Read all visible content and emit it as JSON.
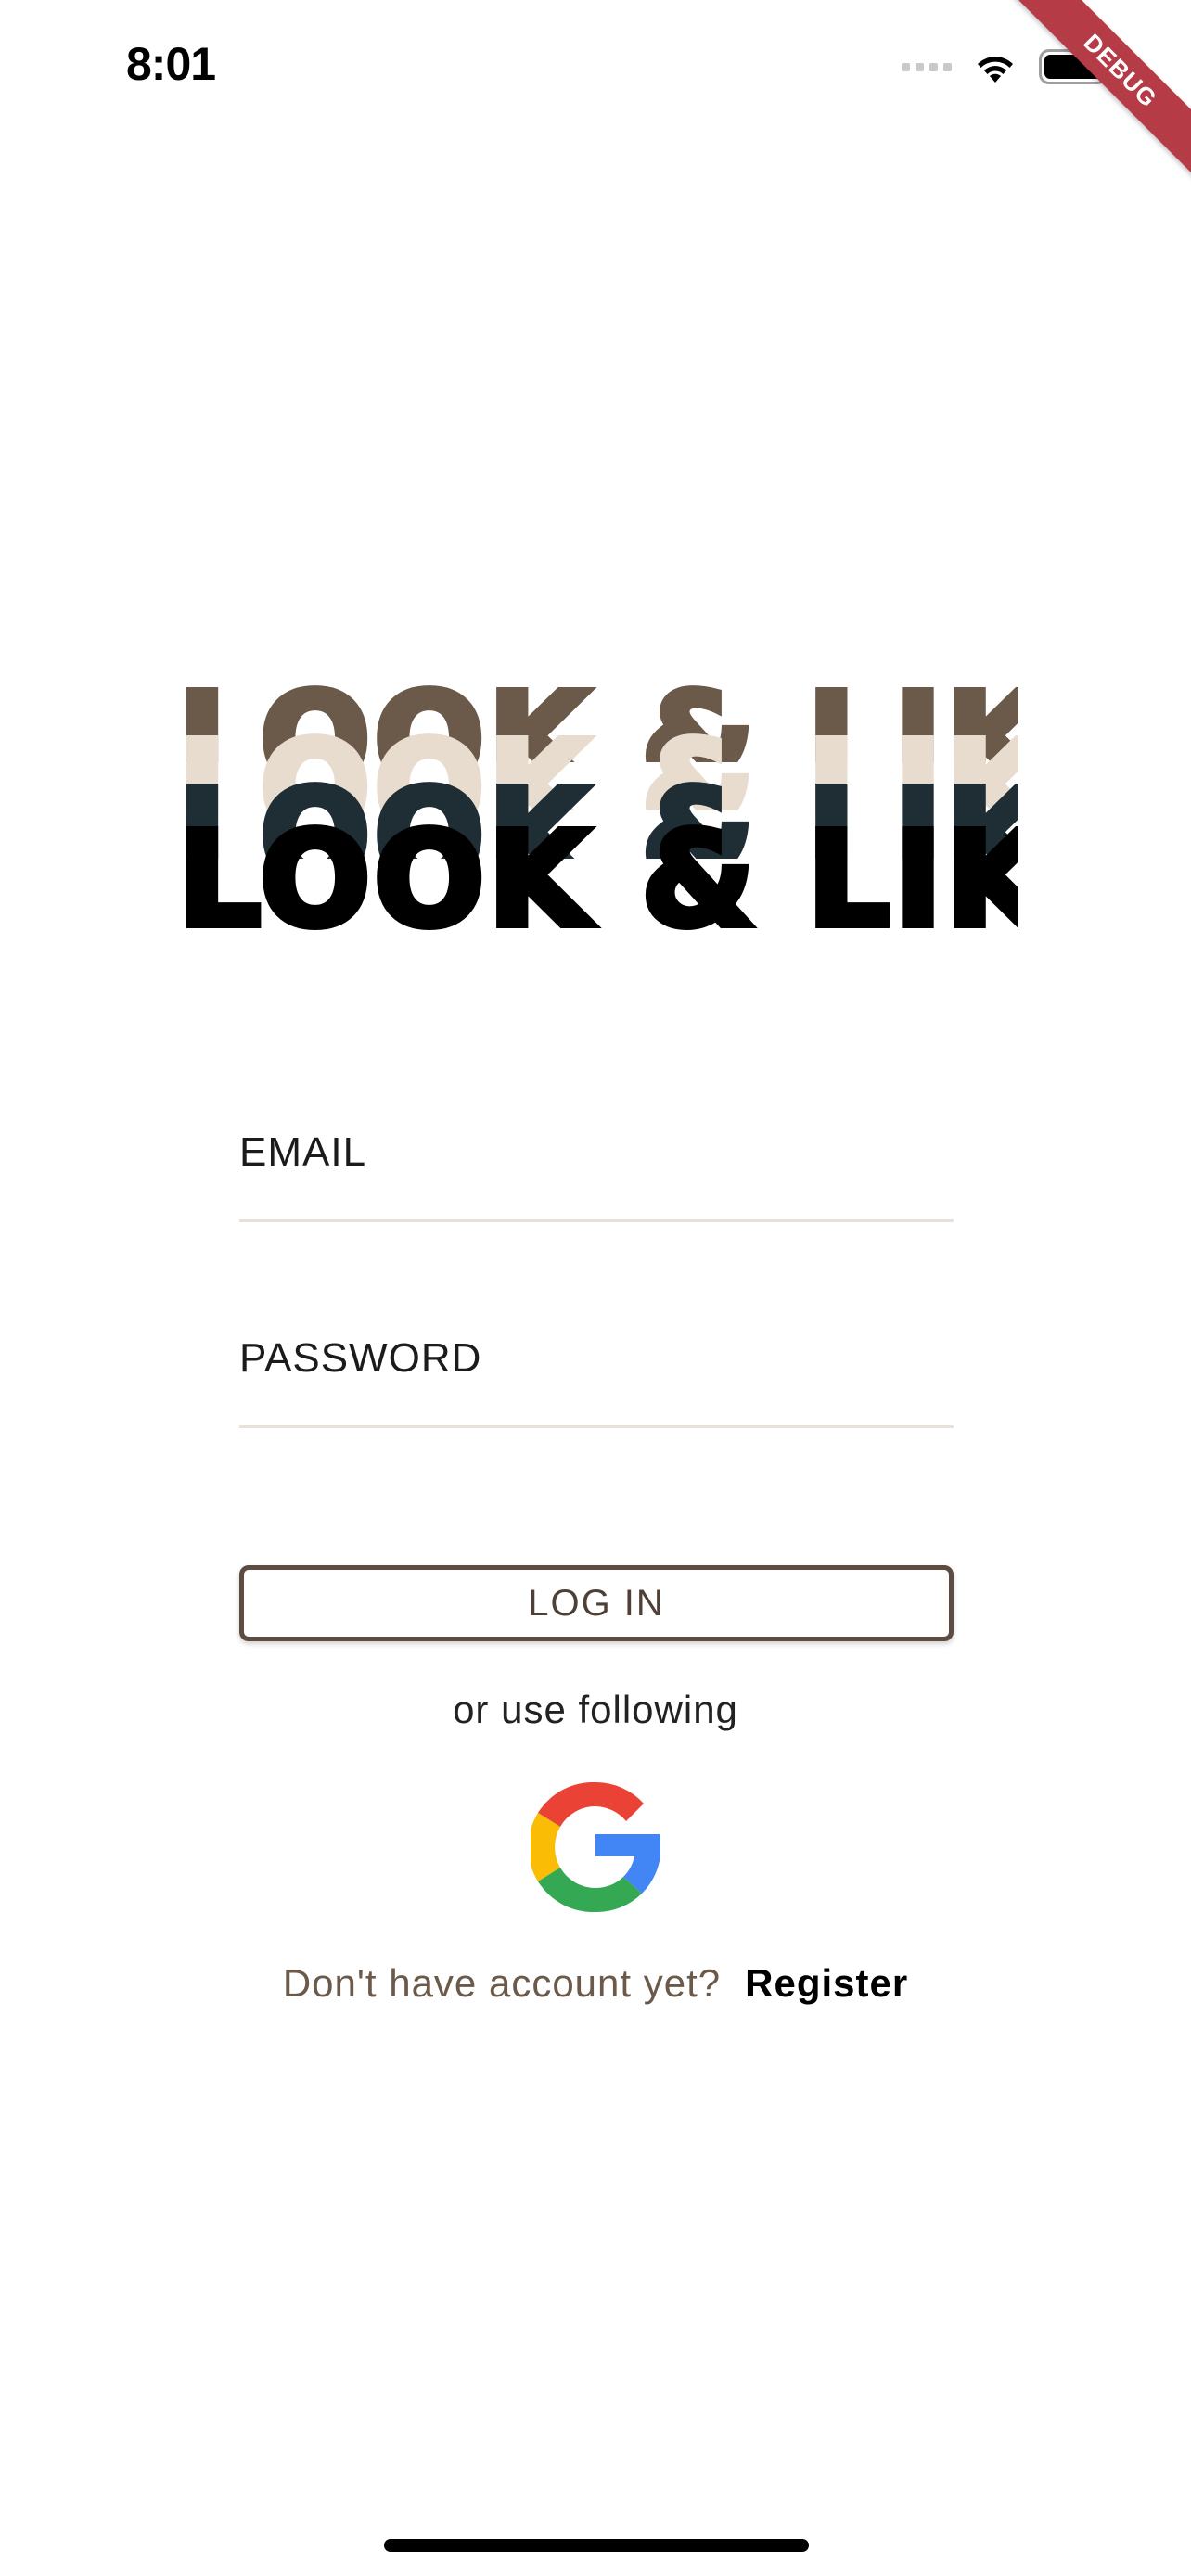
{
  "status_bar": {
    "time": "8:01",
    "icons": [
      "cellular-signal-icon",
      "wifi-icon",
      "battery-icon"
    ]
  },
  "debug_banner": {
    "label": "DEBUG",
    "color": "#b53b46"
  },
  "logo": {
    "text": "LOOK & LIKE",
    "layer_colors": [
      "#6b5a4a",
      "#e8dccf",
      "#1f2e35",
      "#000000"
    ]
  },
  "form": {
    "email_placeholder": "EMAIL",
    "password_placeholder": "PASSWORD",
    "login_label": "LOG IN"
  },
  "alt_login": {
    "text": "or use following",
    "google_icon": "google-icon"
  },
  "register": {
    "question": "Don't have account yet?",
    "link": "Register"
  },
  "colors": {
    "accent_brown": "#5d4c41",
    "divider": "#e8e1d8"
  }
}
